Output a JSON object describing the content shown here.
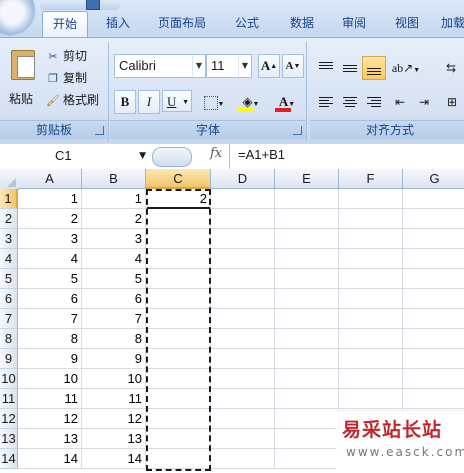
{
  "ribbon": {
    "tabs": [
      "开始",
      "插入",
      "页面布局",
      "公式",
      "数据",
      "审阅",
      "视图",
      "加载"
    ],
    "active_tab": "开始",
    "clipboard": {
      "paste_label": "粘贴",
      "cut_label": "剪切",
      "copy_label": "复制",
      "format_painter_label": "格式刷",
      "group_label": "剪贴板"
    },
    "font": {
      "font_name": "Calibri",
      "font_size": "11",
      "grow_font": "A",
      "shrink_font": "A",
      "bold": "B",
      "italic": "I",
      "underline": "U",
      "font_color_letter": "A",
      "group_label": "字体"
    },
    "alignment": {
      "group_label": "对齐方式"
    }
  },
  "formula_bar": {
    "name_box": "C1",
    "fx_label": "fx",
    "formula": "=A1+B1"
  },
  "sheet": {
    "columns": [
      "A",
      "B",
      "C",
      "D",
      "E",
      "F",
      "G"
    ],
    "selected_column": "C",
    "selected_row": "1",
    "rows": [
      {
        "row": "1",
        "A": "1",
        "B": "1",
        "C": "2"
      },
      {
        "row": "2",
        "A": "2",
        "B": "2",
        "C": ""
      },
      {
        "row": "3",
        "A": "3",
        "B": "3",
        "C": ""
      },
      {
        "row": "4",
        "A": "4",
        "B": "4",
        "C": ""
      },
      {
        "row": "5",
        "A": "5",
        "B": "5",
        "C": ""
      },
      {
        "row": "6",
        "A": "6",
        "B": "6",
        "C": ""
      },
      {
        "row": "7",
        "A": "7",
        "B": "7",
        "C": ""
      },
      {
        "row": "8",
        "A": "8",
        "B": "8",
        "C": ""
      },
      {
        "row": "9",
        "A": "9",
        "B": "9",
        "C": ""
      },
      {
        "row": "10",
        "A": "10",
        "B": "10",
        "C": ""
      },
      {
        "row": "11",
        "A": "11",
        "B": "11",
        "C": ""
      },
      {
        "row": "12",
        "A": "12",
        "B": "12",
        "C": ""
      },
      {
        "row": "13",
        "A": "13",
        "B": "13",
        "C": ""
      },
      {
        "row": "14",
        "A": "14",
        "B": "14",
        "C": ""
      }
    ]
  },
  "watermark": {
    "chinese": "易采站长站",
    "url": "www.easck.com"
  },
  "colors": {
    "accent_blue": "#15428b",
    "selected_header": "#f4c56a",
    "font_color_bar": "#e81c1c",
    "highlight_bar": "#ffff00"
  }
}
